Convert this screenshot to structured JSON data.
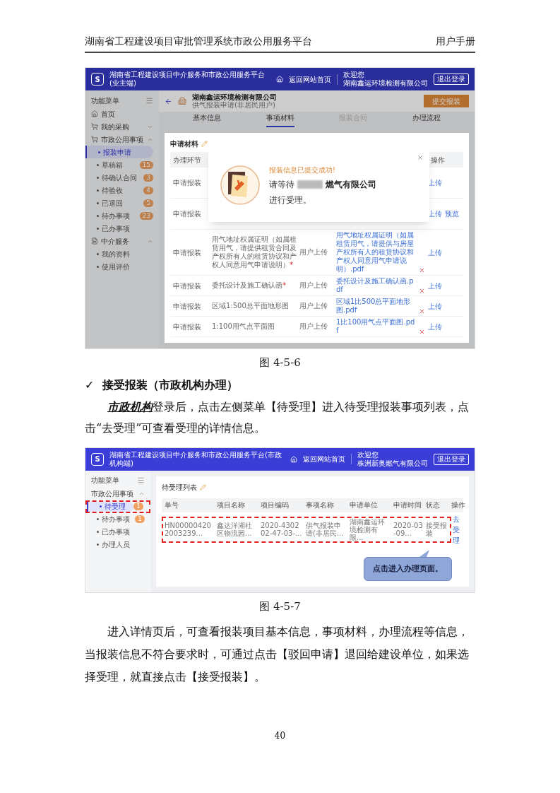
{
  "page_header": {
    "title": "湖南省工程建设项目审批管理系统市政公用服务平台",
    "section": "用户手册"
  },
  "figure_1": {
    "app_header": {
      "logo": "S",
      "title": "湖南省工程建设项目中介服务和市政公用服务平台(业主端)",
      "home_link": "返回网站首页",
      "welcome": "欢迎您",
      "user": "湖南鑫运环境检测有限公司",
      "logout": "退出登录"
    },
    "sidebar": {
      "title": "功能菜单",
      "items": [
        {
          "label": "首页",
          "kind": "home"
        },
        {
          "label": "我的采购",
          "kind": "cart",
          "expanded": false
        },
        {
          "label": "市政公用事项",
          "kind": "cart",
          "expanded": true,
          "children": [
            {
              "label": "报装申请",
              "selected": true
            },
            {
              "label": "草稿箱",
              "selected": false,
              "badge": "15"
            },
            {
              "label": "待确认合同",
              "selected": false,
              "badge": "3"
            },
            {
              "label": "待验收",
              "selected": false,
              "badge": "4"
            },
            {
              "label": "已退回",
              "selected": false,
              "badge": "5"
            },
            {
              "label": "待办事项",
              "selected": false,
              "badge": "23"
            },
            {
              "label": "已办事项",
              "selected": false
            }
          ]
        },
        {
          "label": "中介服务",
          "kind": "doc",
          "expanded": true,
          "children": [
            {
              "label": "我的资料",
              "selected": false
            },
            {
              "label": "使用评价",
              "selected": false
            }
          ]
        }
      ]
    },
    "project": {
      "name": "湖南鑫运环境检测有限公司",
      "subtitle": "供气报装申请(非居民用户)",
      "submit": "提交报装"
    },
    "tabs": [
      {
        "label": "基本信息",
        "selected": false,
        "disabled": false
      },
      {
        "label": "事项材料",
        "selected": true,
        "disabled": false
      },
      {
        "label": "报装合同",
        "selected": false,
        "disabled": true
      },
      {
        "label": "办理流程",
        "selected": false,
        "disabled": false
      }
    ],
    "section_title": "申请材料",
    "table": {
      "first_column": "办理环节",
      "last_column": "操作",
      "rows": [
        {
          "stage": "申请报装",
          "actions": [
            "上传"
          ]
        },
        {
          "stage": "申请报装",
          "actions": [
            "上传",
            "预览"
          ]
        },
        {
          "stage": "申请报装",
          "material": "用气地址权属证明（如属租赁用气，请提供租赁合同及产权所有人的租赁协议和产权人同意用气申请说明）",
          "required_mark": "*",
          "source": "用户上传",
          "file": "用气地址权属证明（如属租赁用气，请提供与房屋产权所有人的租赁协议和产权人同意用气申请说明）.pdf",
          "actions": [
            "上传"
          ]
        },
        {
          "stage": "申请报装",
          "material": "委托设计及施工确认函",
          "required_mark": "*",
          "source": "用户上传",
          "file": "委托设计及施工确认函.pdf",
          "actions": [
            "上传"
          ]
        },
        {
          "stage": "申请报装",
          "material": "区域1:500总平面地形图",
          "source": "用户上传",
          "file": "区域1比500总平面地形图.pdf",
          "actions": [
            "上传"
          ]
        },
        {
          "stage": "申请报装",
          "material": "1:100用气点平面图",
          "source": "用户上传",
          "file": "1比100用气点平面图.pdf",
          "actions": [
            "上传"
          ]
        }
      ]
    },
    "dialog": {
      "status": "报装信息已提交成功!",
      "message_before": "请等待",
      "redacted": true,
      "company": "燃气有限公司",
      "message_after": "进行受理。"
    },
    "caption": "图 4-5-6"
  },
  "heading": {
    "mark": "✓",
    "text": "接受报装（市政机构办理）"
  },
  "paragraph_1": "**市政机构**登录后，点击左侧菜单【待受理】进入待受理报装事项列表，点击“去受理”可查看受理的详情信息。",
  "figure_2": {
    "app_header": {
      "logo": "S",
      "title": "湖南省工程建设项目中介服务和市政公用服务平台(市政机构端)",
      "home_link": "返回网站首页",
      "welcome": "欢迎您",
      "user": "株洲新奥燃气有限公司",
      "logout": "退出登录"
    },
    "sidebar": {
      "title": "功能菜单",
      "items": [
        {
          "label": "市政公用事项",
          "expanded": true,
          "children": [
            {
              "label": "待受理",
              "selected": true,
              "badge": "1",
              "highlighted": true
            },
            {
              "label": "待办事项",
              "selected": false,
              "badge": "1"
            },
            {
              "label": "已办事项",
              "selected": false
            },
            {
              "label": "办理人员",
              "selected": false
            }
          ]
        }
      ]
    },
    "section_title": "待受理列表",
    "table": {
      "columns": [
        "单号",
        "项目名称",
        "项目编码",
        "事项名称",
        "申请单位",
        "申请时间",
        "状态",
        "操作"
      ],
      "rows": [
        {
          "cells": [
            "HN000004202003239...",
            "鑫达洋湖社区物流园...",
            "2020-430202-47-03-...",
            "供气报装申请(非居民...",
            "湖南鑫运环境检测有限...",
            "2020-03-09...",
            "接受报装"
          ],
          "action": "去受理",
          "highlighted": true
        }
      ]
    },
    "callout": "点击进入办理页面。",
    "caption": "图 4-5-7"
  },
  "paragraph_2": "进入详情页后，可查看报装项目基本信息，事项材料，办理流程等信息，当报装信息不符合要求时，可通过点击【驳回申请】退回给建设单位，如果选择受理，就直接点击【接受报装】。",
  "page_number": "40"
}
